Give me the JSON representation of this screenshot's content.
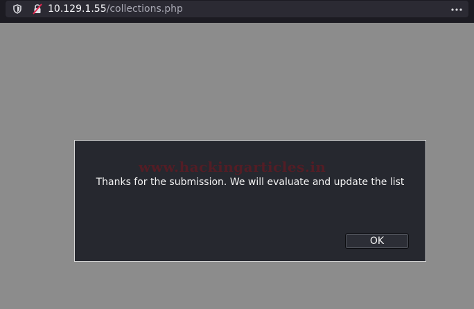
{
  "browser": {
    "url_host": "10.129.1.55",
    "url_path": "/collections.php",
    "icons": {
      "shield": "shield-icon",
      "insecure": "insecure-lock-icon",
      "menu": "page-actions-menu-icon"
    }
  },
  "dialog": {
    "watermark": "www.hackingarticles.in",
    "message": "Thanks for the submission. We will evaluate and update the list",
    "ok_label": "OK"
  },
  "colors": {
    "page_background": "#8c8c8c",
    "dialog_background": "#26282f",
    "toolbar_background": "#1c1b22",
    "watermark": "#78141e"
  }
}
